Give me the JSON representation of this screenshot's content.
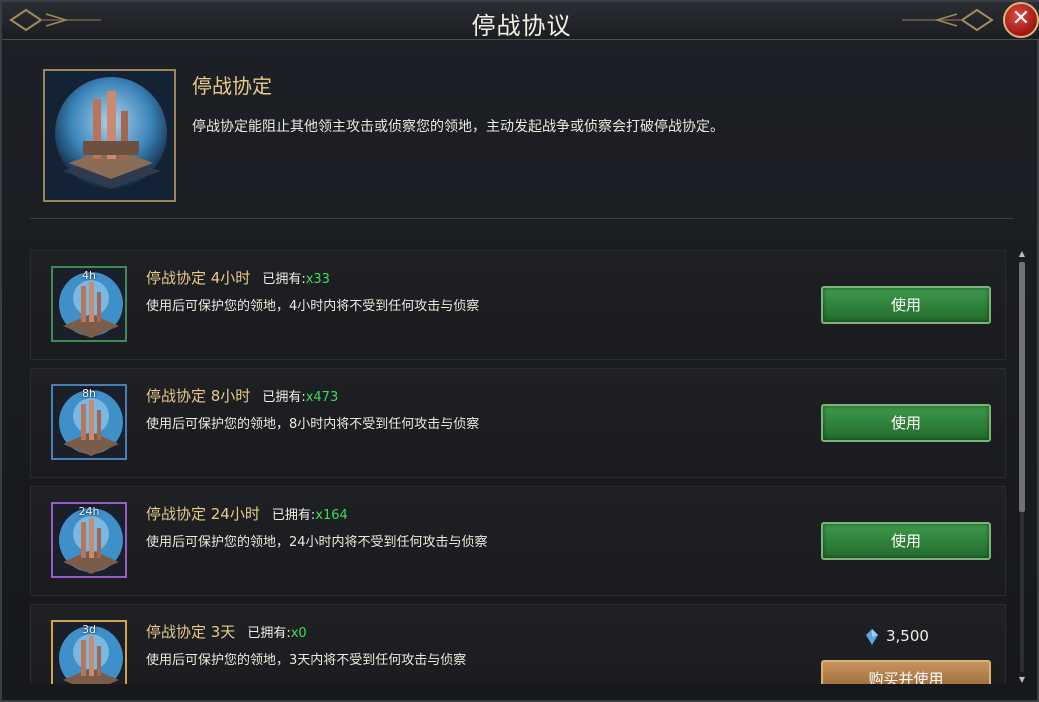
{
  "window": {
    "title": "停战协议",
    "close_symbol": "✕"
  },
  "header": {
    "item_name": "停战协定",
    "description": "停战协定能阻止其他领主攻击或侦察您的领地，主动发起战争或侦察会打破停战协定。"
  },
  "owned_label": "已拥有:",
  "items": [
    {
      "tag": "4h",
      "title": "停战协定 4小时",
      "owned": "x33",
      "desc": "使用后可保护您的领地，4小时内将不受到任何攻击与侦察",
      "action": "使用",
      "frame_color": "#3f8b57"
    },
    {
      "tag": "8h",
      "title": "停战协定 8小时",
      "owned": "x473",
      "desc": "使用后可保护您的领地，8小时内将不受到任何攻击与侦察",
      "action": "使用",
      "frame_color": "#4a7fb6"
    },
    {
      "tag": "24h",
      "title": "停战协定 24小时",
      "owned": "x164",
      "desc": "使用后可保护您的领地，24小时内将不受到任何攻击与侦察",
      "action": "使用",
      "frame_color": "#9a5cc4"
    },
    {
      "tag": "3d",
      "title": "停战协定 3天",
      "owned": "x0",
      "desc": "使用后可保护您的领地，3天内将不受到任何攻击与侦察",
      "price": "3,500",
      "action": "购买并使用",
      "frame_color": "#d8a24a"
    }
  ]
}
